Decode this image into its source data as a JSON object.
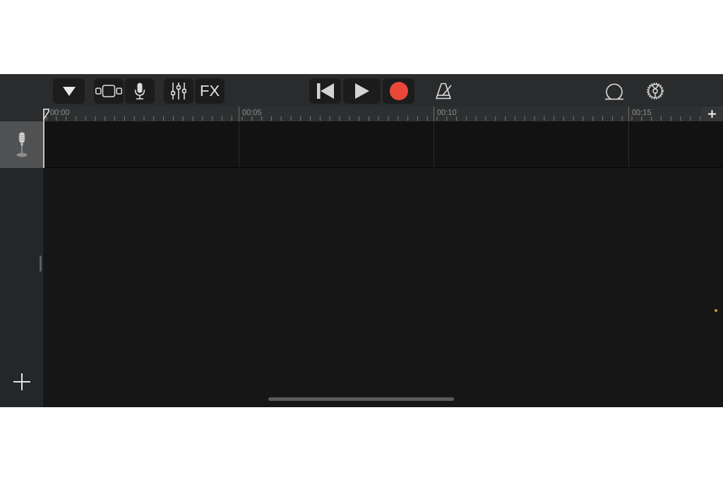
{
  "toolbar": {
    "effects_button": "FX"
  },
  "timeline": {
    "marks": [
      "00:00",
      "00:05",
      "00:10",
      "00:15"
    ]
  },
  "tracks": [
    {
      "kind": "audio",
      "selected": true
    }
  ]
}
